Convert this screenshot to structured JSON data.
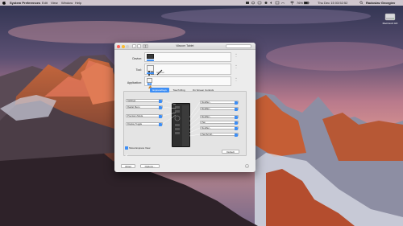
{
  "menubar": {
    "apple": "",
    "app": "System Preferences",
    "items": [
      "Edit",
      "View",
      "Window",
      "Help"
    ],
    "battery": "76%",
    "clock": "Thu Dec 15 03:52:52",
    "user": "Radoslav Georgiev"
  },
  "desktop": {
    "disk_label": "Macintosh HD"
  },
  "window": {
    "title": "Wacom Tablet",
    "rows": {
      "device_label": "Device:",
      "tool_label": "Tool:",
      "tool_caption": "Grip Pen",
      "application_label": "Application:",
      "application_caption": "All"
    },
    "tabs": [
      "ExpressKeys",
      "Touch Ring",
      "On Screen Controls"
    ],
    "active_tab": "ExpressKeys",
    "left_popups": [
      "Settings",
      "Radial Menu",
      "Precision Mode",
      "Display Toggle"
    ],
    "right_popups": [
      "Modifier...",
      "Modifier...",
      "Modifier...",
      "Pan",
      "Modifier...",
      "Pan/Scroll..."
    ],
    "show_express_view": "Show Express View",
    "default_button": "Default",
    "about_button": "About",
    "options_button": "Options..."
  },
  "colors": {
    "accent": "#3d8ef5",
    "close": "#fc5f57",
    "minimize": "#fdbc2e",
    "zoom": "#cfcfcf"
  },
  "icons": [
    "apple-icon",
    "wifi-icon",
    "battery-icon",
    "search-icon",
    "spotlight-icon",
    "disk-icon",
    "grid-icon"
  ]
}
